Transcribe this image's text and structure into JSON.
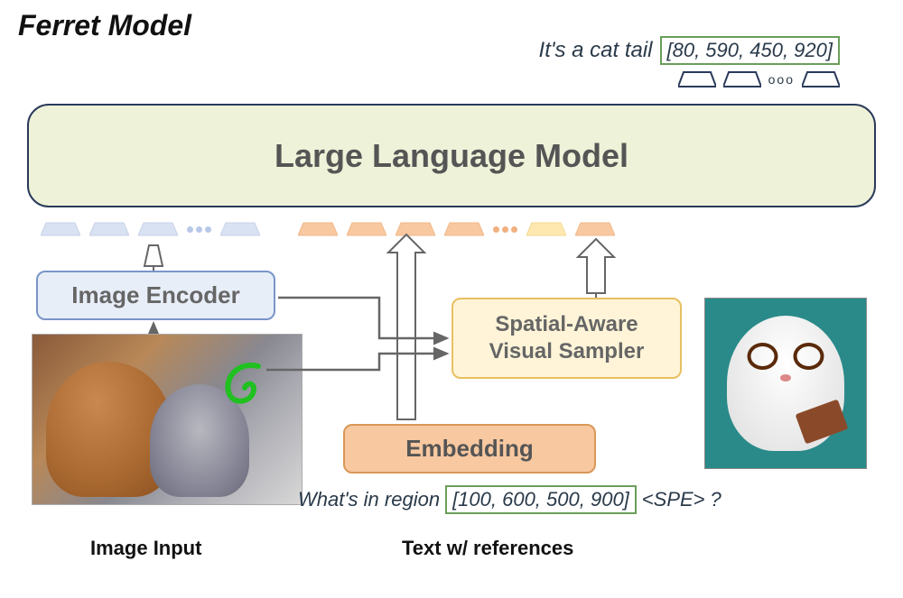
{
  "title": "Ferret Model",
  "output": {
    "text": "It's a cat tail",
    "coords": "[80, 590, 450, 920]",
    "ellipsis": "ooo"
  },
  "llm": {
    "label": "Large Language Model"
  },
  "encoder": {
    "label": "Image Encoder"
  },
  "sampler": {
    "line1": "Spatial-Aware",
    "line2": "Visual Sampler"
  },
  "embedding": {
    "label": "Embedding"
  },
  "query": {
    "prefix": "What's in region",
    "coords": "[100, 600, 500, 900]",
    "spe": "<SPE>",
    "suffix": "?"
  },
  "labels": {
    "image_input": "Image Input",
    "text_ref": "Text w/ references"
  },
  "token_ellipsis": "•••"
}
